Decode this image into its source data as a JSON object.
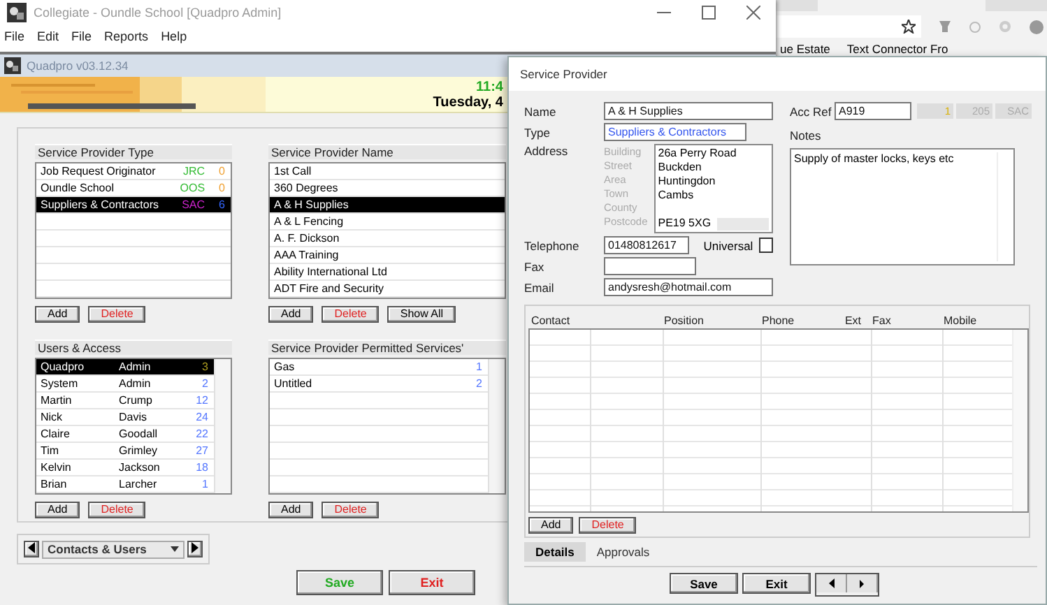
{
  "main_window": {
    "title": "Collegiate - Oundle School [Quadpro Admin]",
    "menu": [
      "File",
      "Edit",
      "File",
      "Reports",
      "Help"
    ]
  },
  "app_window": {
    "title": "Quadpro v03.12.34",
    "time": "11:4",
    "date": "Tuesday, 4"
  },
  "provider_types": {
    "title": "Service Provider Type",
    "rows": [
      {
        "name": "Job Request Originator",
        "code": {
          "text": "JRC",
          "color": "#33bb33"
        },
        "count": {
          "text": "0",
          "color": "#f0a030"
        },
        "selected": false
      },
      {
        "name": "Oundle School",
        "code": {
          "text": "OOS",
          "color": "#33bb33"
        },
        "count": {
          "text": "0",
          "color": "#f0a030"
        },
        "selected": false
      },
      {
        "name": "Suppliers & Contractors",
        "code": {
          "text": "SAC",
          "color": "#cc22cc"
        },
        "count": {
          "text": "6",
          "color": "#3366ff"
        },
        "selected": true
      }
    ],
    "buttons": [
      {
        "label": "Add",
        "kind": "normal"
      },
      {
        "label": "Delete",
        "kind": "danger"
      }
    ]
  },
  "provider_names": {
    "title": "Service Provider Name",
    "rows": [
      {
        "name": "1st Call",
        "selected": false
      },
      {
        "name": "360 Degrees",
        "selected": false
      },
      {
        "name": "A & H Supplies",
        "selected": true
      },
      {
        "name": "A & L Fencing",
        "selected": false
      },
      {
        "name": "A. F. Dickson",
        "selected": false
      },
      {
        "name": "AAA Training",
        "selected": false
      },
      {
        "name": "Ability International Ltd",
        "selected": false
      },
      {
        "name": "ADT Fire and Security",
        "selected": false
      }
    ],
    "buttons": [
      {
        "label": "Add",
        "kind": "normal"
      },
      {
        "label": "Delete",
        "kind": "danger"
      },
      {
        "label": "Show All",
        "kind": "normal"
      }
    ]
  },
  "users": {
    "title": "Users & Access",
    "rows": [
      {
        "first": "Quadpro",
        "last": "Admin",
        "count": "3",
        "selected": true
      },
      {
        "first": "System",
        "last": "Admin",
        "count": "2",
        "selected": false
      },
      {
        "first": "Martin",
        "last": "Crump",
        "count": "12",
        "selected": false
      },
      {
        "first": "Nick",
        "last": "Davis",
        "count": "24",
        "selected": false
      },
      {
        "first": "Claire",
        "last": "Goodall",
        "count": "22",
        "selected": false
      },
      {
        "first": "Tim",
        "last": "Grimley",
        "count": "27",
        "selected": false
      },
      {
        "first": "Kelvin",
        "last": "Jackson",
        "count": "18",
        "selected": false
      },
      {
        "first": "Brian",
        "last": "Larcher",
        "count": "1",
        "selected": false
      }
    ],
    "buttons": [
      {
        "label": "Add",
        "kind": "normal"
      },
      {
        "label": "Delete",
        "kind": "danger"
      }
    ]
  },
  "permitted_services": {
    "title": "Service Provider Permitted Services'",
    "rows": [
      {
        "name": "Gas",
        "count": "1",
        "selected": false
      },
      {
        "name": "Untitled",
        "count": "2",
        "selected": false
      }
    ],
    "buttons": [
      {
        "label": "Add",
        "kind": "normal"
      },
      {
        "label": "Delete",
        "kind": "danger"
      }
    ]
  },
  "navigator": {
    "value": "Contacts & Users"
  },
  "footer_buttons": [
    {
      "label": "Save",
      "kind": "confirm"
    },
    {
      "label": "Exit",
      "kind": "danger"
    }
  ],
  "browser": {
    "bookmarks": [
      "ue Estate",
      "Text Connector Fro"
    ]
  },
  "dialog": {
    "title": "Service Provider",
    "name": {
      "label": "Name",
      "value": "A & H Supplies"
    },
    "acc_ref": {
      "label": "Acc Ref",
      "value": "A919",
      "info": [
        "1",
        "205",
        "SAC"
      ]
    },
    "type": {
      "label": "Type",
      "value": "Suppliers & Contractors"
    },
    "notes": {
      "label": "Notes",
      "value": "Supply of master locks, keys etc"
    },
    "address": {
      "label": "Address",
      "lines": [
        {
          "label": "Building",
          "value": "26a Perry Road"
        },
        {
          "label": "Street",
          "value": "Buckden"
        },
        {
          "label": "Area",
          "value": "Huntingdon"
        },
        {
          "label": "Town",
          "value": "Cambs"
        },
        {
          "label": "County"
        },
        {
          "label": "Postcode",
          "value": "PE19 5XG"
        }
      ]
    },
    "telephone": {
      "label": "Telephone",
      "value": "01480812617"
    },
    "universal": {
      "label": "Universal",
      "checked": false
    },
    "fax": {
      "label": "Fax"
    },
    "email": {
      "label": "Email",
      "value": "andysresh@hotmail.com"
    },
    "contacts_table": {
      "columns": [
        "Contact",
        "Position",
        "Phone",
        "Ext",
        "Fax",
        "Mobile"
      ],
      "buttons": [
        {
          "label": "Add",
          "kind": "normal"
        },
        {
          "label": "Delete",
          "kind": "danger"
        }
      ]
    },
    "tabs": [
      {
        "label": "Details",
        "selected": true
      },
      {
        "label": "Approvals",
        "selected": false
      }
    ],
    "buttons": [
      {
        "label": "Save",
        "kind": "normal"
      },
      {
        "label": "Exit",
        "kind": "normal"
      }
    ]
  }
}
